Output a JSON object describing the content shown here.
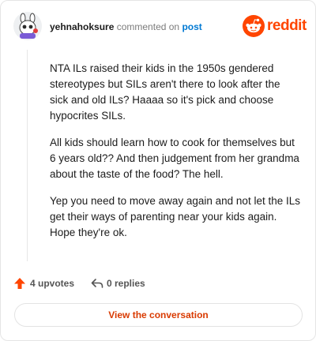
{
  "comment": {
    "username": "yehnahoksure",
    "verb": "commented on",
    "target": "post",
    "paragraphs": [
      "NTA ILs raised their kids in the 1950s gendered stereotypes but SILs aren't there to look after the sick and old ILs? Haaaa so it's pick and choose hypocrites SILs.",
      "All kids should learn how to cook for themselves but 6 years old?? And then judgement from her grandma about the taste of the food? The hell.",
      "Yep you need to move away again and not let the ILs get their ways of parenting near your kids again. Hope they're ok."
    ]
  },
  "brand": {
    "name": "reddit",
    "icon": "reddit-logo-icon",
    "color": "#ff4500"
  },
  "stats": {
    "upvotes": "4 upvotes",
    "replies": "0 replies",
    "upvote_icon": "upvote-arrow-icon",
    "reply_icon": "reply-arrow-icon",
    "upvote_color": "#ff4500"
  },
  "cta": {
    "label": "View the conversation",
    "color": "#d93a00"
  }
}
